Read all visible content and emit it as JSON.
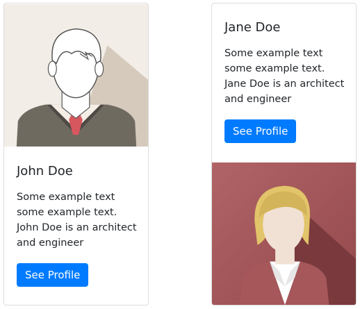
{
  "cards": [
    {
      "name": "John Doe",
      "text": "Some example text some example text. John Doe is an architect and engineer",
      "button_label": "See Profile",
      "avatar_icon": "male-avatar-icon"
    },
    {
      "name": "Jane Doe",
      "text": "Some example text some example text. Jane Doe is an architect and engineer",
      "button_label": "See Profile",
      "avatar_icon": "female-avatar-icon"
    }
  ],
  "colors": {
    "button_bg": "#007bff",
    "john_bg": "#f2ede6",
    "jane_bg": "#a5575a"
  }
}
